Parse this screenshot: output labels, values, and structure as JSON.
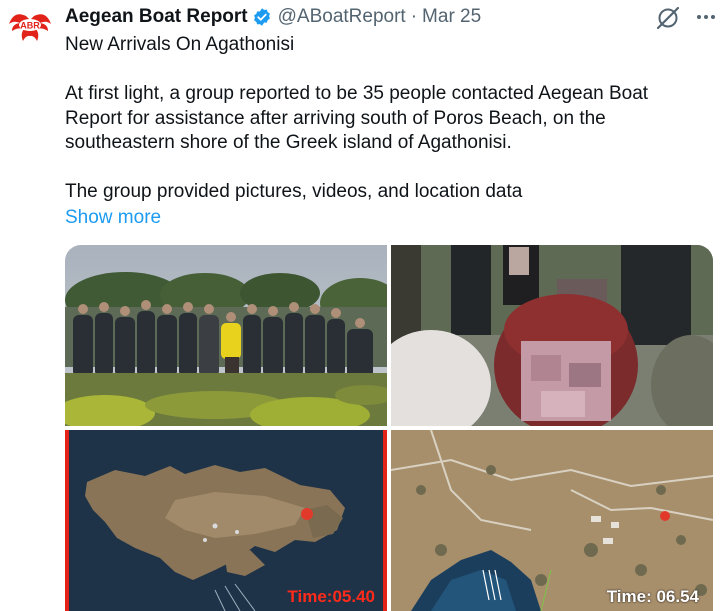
{
  "author": {
    "name": "Aegean Boat Report",
    "handle": "@ABoatReport",
    "date": "Mar 25",
    "avatar_text": "ABR",
    "verified_icon": "verified-badge-icon"
  },
  "tweet": {
    "title": "New Arrivals On Agathonisi",
    "para1": "At first light, a group reported to be 35 people contacted Aegean Boat Report for assistance after arriving south of Poros Beach, on the southeastern shore of the Greek island of Agathonisi.",
    "para2": "The group provided pictures, videos, and location data",
    "show_more": "Show more"
  },
  "media": {
    "map1_time": "Time:05.40",
    "map2_time": "Time: 06.54"
  },
  "colors": {
    "link": "#1d9bf0",
    "verified": "#1d9bf0",
    "time_red": "#ff2a1a",
    "brand_red": "#e2231a"
  }
}
